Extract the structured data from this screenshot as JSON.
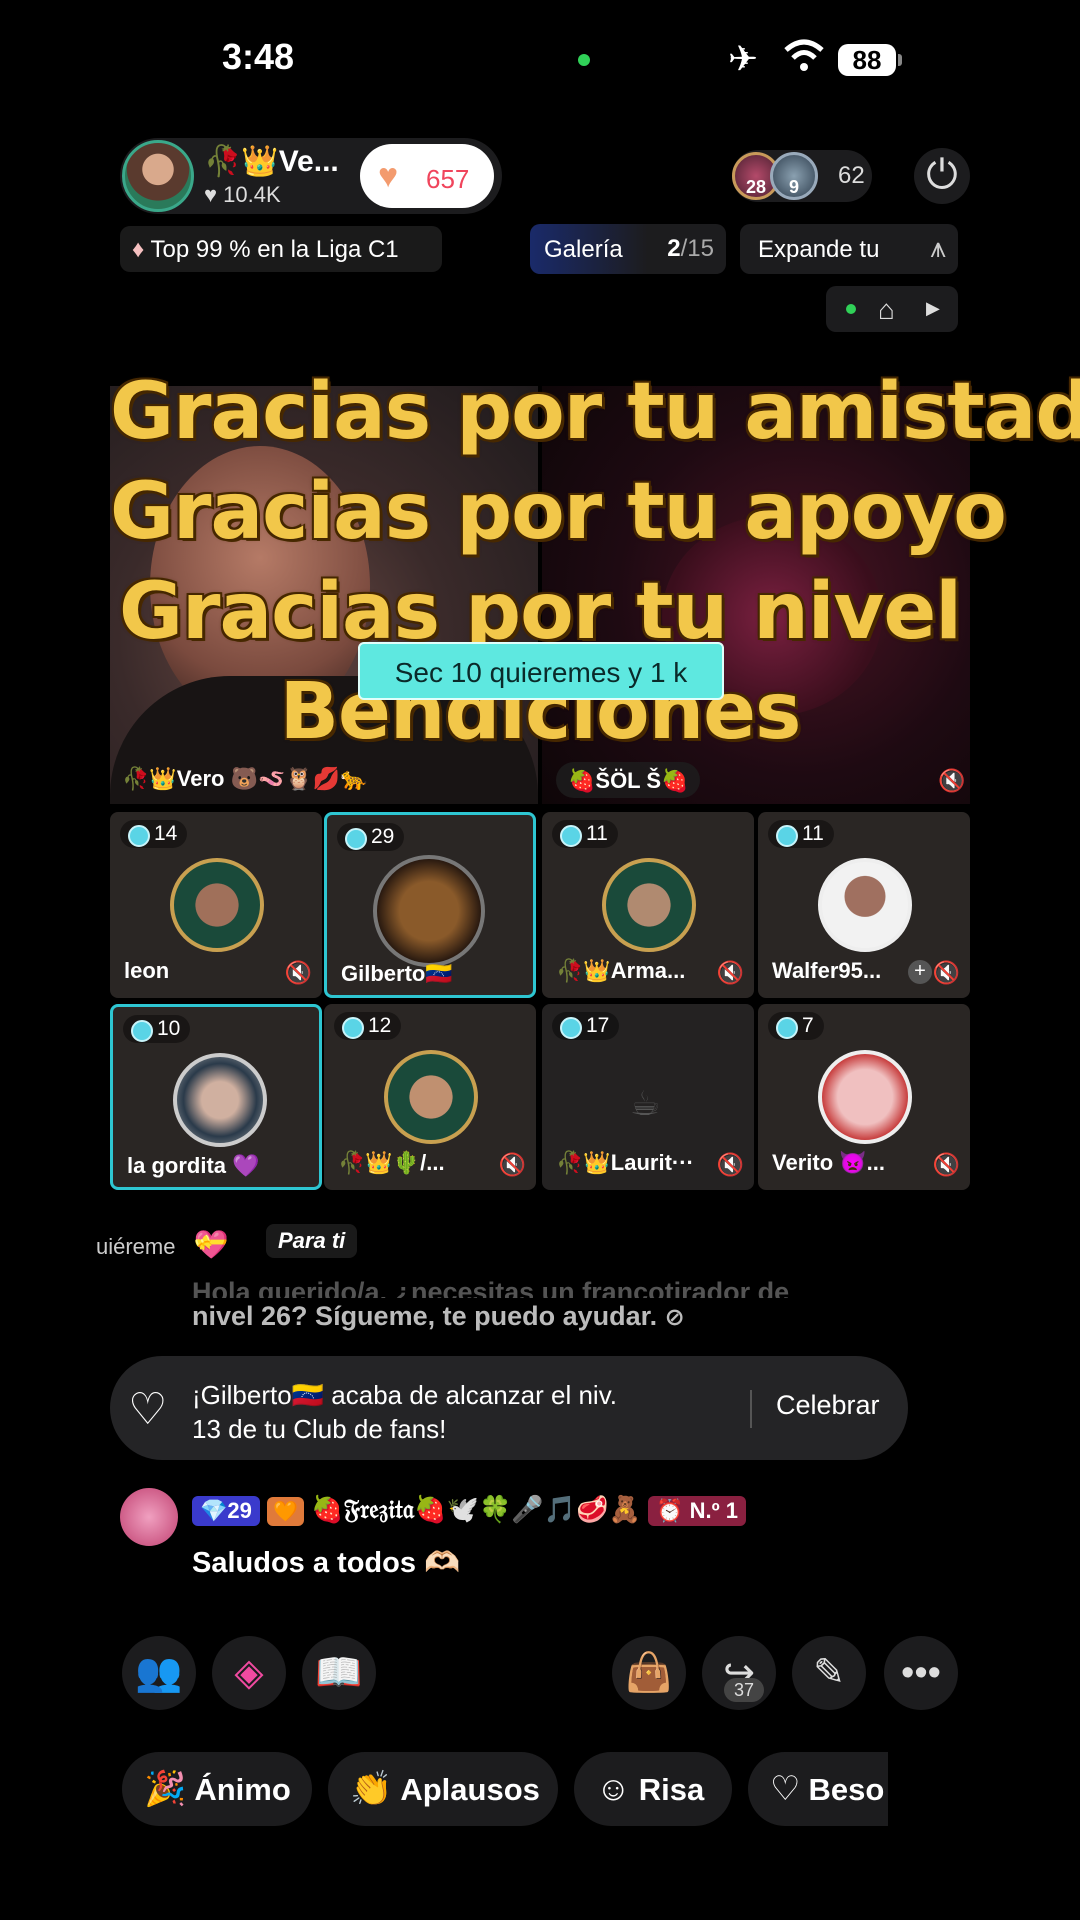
{
  "status_bar": {
    "time": "3:48",
    "battery": "88"
  },
  "host": {
    "name": "🥀👑Ve...",
    "likes": "♥ 10.4K",
    "follow_count": "657"
  },
  "viewers": {
    "avatar1_badge": "28",
    "avatar2_badge": "9",
    "count": "62"
  },
  "league": {
    "text": "Top 99 % en la Liga C1"
  },
  "gallery": {
    "label": "Galería",
    "current": "2",
    "total": "/15"
  },
  "expand": {
    "label": "Expande tu"
  },
  "overlay": {
    "line1": "Gracias por tu amistad",
    "line2": "Gracias por tu apoyo",
    "line3": "Gracias por tu nivel",
    "line4": "Bendiciones"
  },
  "topic_banner": "Sec 10 quieremes y 1 k",
  "video1_name": "🥀👑Vero 🐻🪱🦉💋🐆",
  "video2_name": "🍓ŠÖL Š🍓",
  "guests": [
    {
      "score": "14",
      "name": "leon"
    },
    {
      "score": "29",
      "name": "Gilberto🇻🇪"
    },
    {
      "score": "11",
      "name": "🥀👑Arma..."
    },
    {
      "score": "11",
      "name": "Walfer95..."
    },
    {
      "score": "10",
      "name": "la gordita 💜"
    },
    {
      "score": "12",
      "name": "🥀👑🌵/..."
    },
    {
      "score": "17",
      "name": "🥀👑Laurit···"
    },
    {
      "score": "7",
      "name": "Verito 👿..."
    }
  ],
  "chat_tabs": {
    "quiereme": "uiéreme",
    "parati": "Para ti"
  },
  "bot_message": {
    "line1": "Hola querido/a, ¿necesitas un francotirador de",
    "line2": "nivel 26? Sígueme, te puedo ayudar."
  },
  "fan_banner": {
    "text": "¡Gilberto🇻🇪 acaba de alcanzar el niv. 13 de tu Club de fans!",
    "action": "Celebrar"
  },
  "chat_message": {
    "level": "💎29",
    "username": "🍓𝔉𝔯𝔢𝔷𝔦𝔱𝔞🍓🕊️🍀🎤🎵🥩🧸",
    "rank": "⏰ N.º 1",
    "text": "Saludos a todos 🫶🏻"
  },
  "share_count": "37",
  "reactions": [
    "Ánimo",
    "Aplausos",
    "Risa",
    "Beso"
  ],
  "colors": {
    "accent_cyan": "#2ec6d2",
    "overlay_gold": "#f2c74a",
    "follow_red": "#f0455c"
  }
}
